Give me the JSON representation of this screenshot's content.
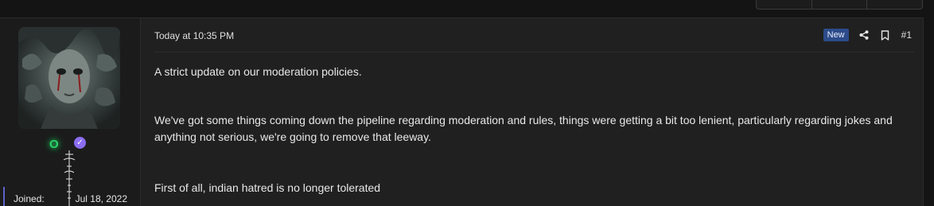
{
  "user": {
    "username": "O",
    "verified_icon": "check-icon",
    "joined_label": "Joined:",
    "joined_value": "Jul 18, 2022"
  },
  "post": {
    "date": "Today at 10:35 PM",
    "badge": "New",
    "share_icon": "share-icon",
    "bookmark_icon": "bookmark-icon",
    "number": "#1",
    "paragraphs": [
      "A strict update on our moderation policies.",
      "We've got some things coming down the pipeline regarding moderation and rules, things were getting a bit too lenient, particularly regarding jokes and anything not serious, we're going to remove that leeway.",
      "First of all, indian hatred is no longer tolerated"
    ]
  },
  "colors": {
    "background": "#141414",
    "post_bg": "#202020",
    "username": "#2bd46a",
    "badge_bg": "#2c4b8a",
    "verified": "#8a6df0",
    "joined_accent": "#5a63c9"
  }
}
